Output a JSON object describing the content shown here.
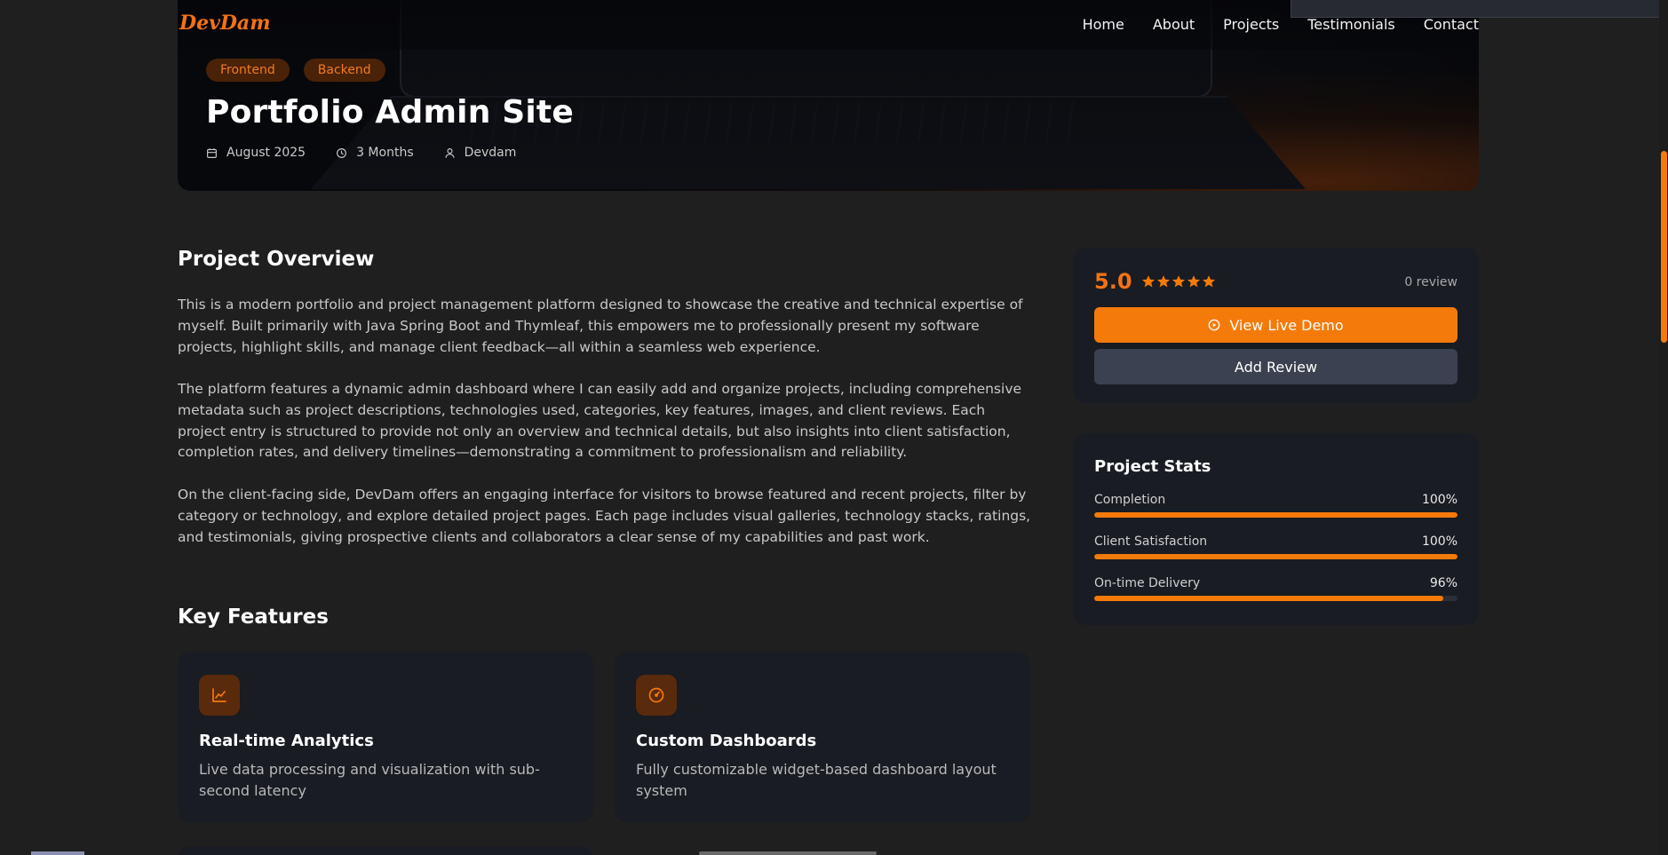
{
  "brand": {
    "logo_text": "DevDam",
    "accent_color": "#f47a0a"
  },
  "nav": {
    "items": [
      "Home",
      "About",
      "Projects",
      "Testimonials",
      "Contact"
    ]
  },
  "hero": {
    "tags": [
      "Frontend",
      "Backend"
    ],
    "title": "Portfolio Admin Site",
    "meta": {
      "date": "August 2025",
      "duration": "3 Months",
      "author": "Devdam"
    }
  },
  "overview": {
    "heading": "Project Overview",
    "paragraphs": [
      "This is a modern portfolio and project management platform designed to showcase the creative and technical expertise of myself. Built primarily with Java Spring Boot and Thymleaf, this empowers me to professionally present my software projects, highlight skills, and manage client feedback—all within a seamless web experience.",
      "The platform features a dynamic admin dashboard where I can easily add and organize projects, including comprehensive metadata such as project descriptions, technologies used, categories, key features, images, and client reviews. Each project entry is structured to provide not only an overview and technical details, but also insights into client satisfaction, completion rates, and delivery timelines—demonstrating a commitment to professionalism and reliability.",
      "On the client-facing side, DevDam offers an engaging interface for visitors to browse featured and recent projects, filter by category or technology, and explore detailed project pages. Each page includes visual galleries, technology stacks, ratings, and testimonials, giving prospective clients and collaborators a clear sense of my capabilities and past work."
    ]
  },
  "features": {
    "heading": "Key Features",
    "items": [
      {
        "icon": "line-chart-icon",
        "title": "Real-time Analytics",
        "description": "Live data processing and visualization with sub-second latency"
      },
      {
        "icon": "gauge-icon",
        "title": "Custom Dashboards",
        "description": "Fully customizable widget-based dashboard layout system"
      }
    ]
  },
  "rating_card": {
    "rating": "5.0",
    "stars": 5,
    "review_count": "0 review",
    "live_demo_label": "View Live Demo",
    "add_review_label": "Add Review"
  },
  "stats": {
    "title": "Project Stats",
    "items": [
      {
        "label": "Completion",
        "display": "100%",
        "value": 100
      },
      {
        "label": "Client Satisfaction",
        "display": "100%",
        "value": 100
      },
      {
        "label": "On-time Delivery",
        "display": "96%",
        "value": 96
      }
    ]
  }
}
